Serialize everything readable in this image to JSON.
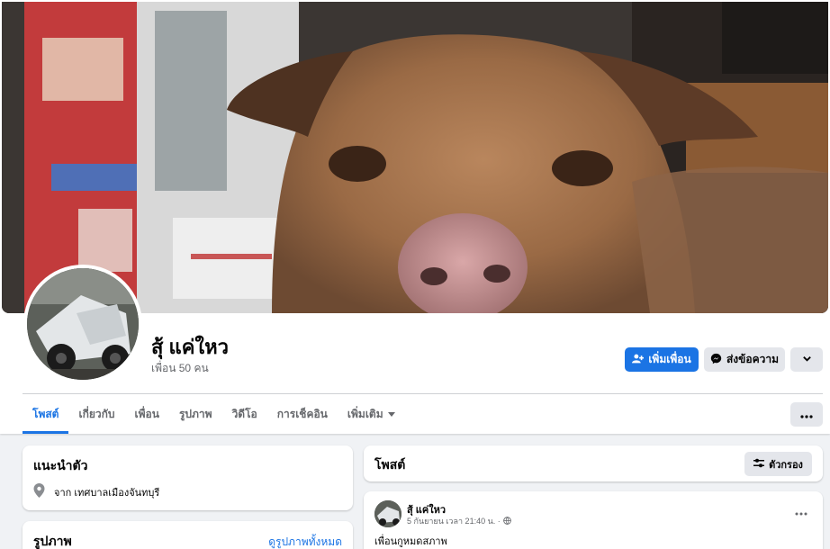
{
  "profile": {
    "name": "สุ้ แค่ใหว",
    "friends": "เพื่อน 50 คน"
  },
  "actions": {
    "add_friend": "เพิ่มเพื่อน",
    "message": "ส่งข้อความ"
  },
  "tabs": [
    {
      "label": "โพสต์"
    },
    {
      "label": "เกี่ยวกับ"
    },
    {
      "label": "เพื่อน"
    },
    {
      "label": "รูปภาพ"
    },
    {
      "label": "วิดีโอ"
    },
    {
      "label": "การเช็คอิน"
    },
    {
      "label": "เพิ่มเติม"
    }
  ],
  "intro": {
    "title": "แนะนำตัว",
    "location": "จาก เทศบาลเมืองจันทบุรี"
  },
  "photos": {
    "title": "รูปภาพ",
    "see_all": "ดูรูปภาพทั้งหมด"
  },
  "posts": {
    "title": "โพสต์",
    "filter": "ตัวกรอง"
  },
  "post": {
    "author": "สุ้ แค่ใหว",
    "time": "5 กันยายน เวลา 21:40 น. ·",
    "text": "เพื่อนกูหมดสภาพ"
  },
  "colors": {
    "accent": "#1b74e4",
    "background": "#f0f2f5",
    "secondary_button": "#e4e6eb",
    "muted_text": "#65676b"
  },
  "icons": {
    "add_friend": "person-plus-icon",
    "message": "messenger-icon",
    "more": "chevron-down-icon",
    "tab_more": "caret-down-icon",
    "tabs_menu": "more-dots-icon",
    "location": "location-pin-icon",
    "filter": "filter-sliders-icon",
    "privacy": "globe-icon",
    "post_menu": "more-dots-icon"
  }
}
